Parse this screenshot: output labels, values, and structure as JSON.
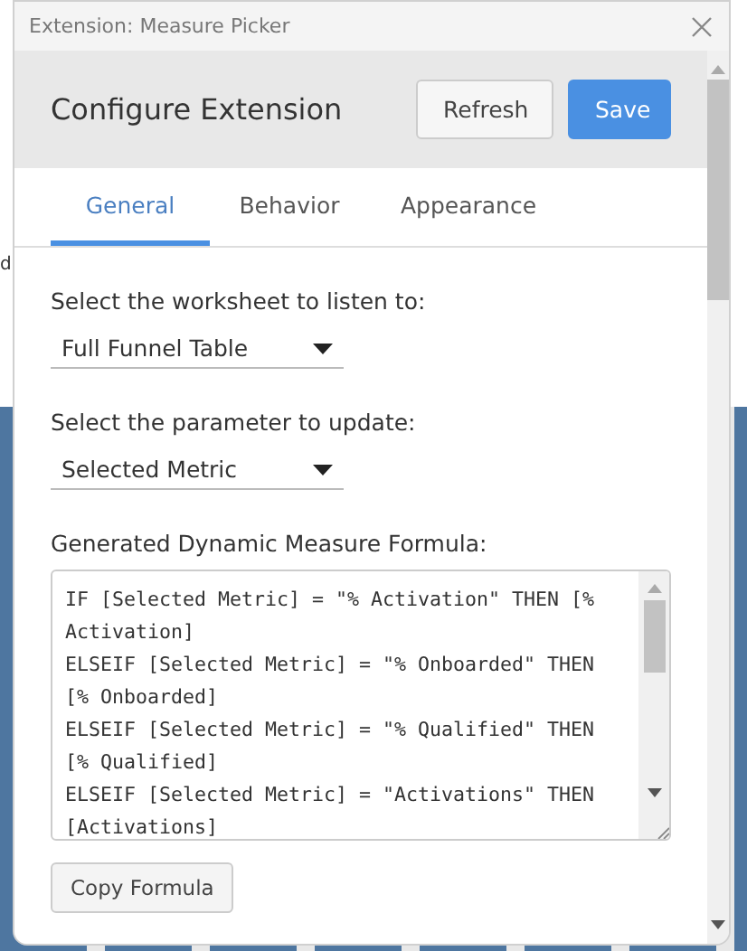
{
  "background_text": "d",
  "window": {
    "title": "Extension: Measure Picker"
  },
  "header": {
    "title": "Configure Extension",
    "buttons": [
      {
        "label": "Refresh",
        "kind": "secondary"
      },
      {
        "label": "Save",
        "kind": "primary"
      }
    ]
  },
  "tabs": [
    {
      "label": "General",
      "selected": true
    },
    {
      "label": "Behavior",
      "selected": false
    },
    {
      "label": "Appearance",
      "selected": false
    }
  ],
  "worksheet": {
    "label": "Select the worksheet to listen to:",
    "value": "Full Funnel Table"
  },
  "parameter": {
    "label": "Select the parameter to update:",
    "value": "Selected Metric"
  },
  "formula": {
    "label": "Generated Dynamic Measure Formula:",
    "lines": [
      "IF [Selected Metric] = \"% Activation\" THEN [% Activation]",
      "ELSEIF [Selected Metric] = \"% Onboarded\" THEN [% Onboarded]",
      "ELSEIF [Selected Metric] = \"% Qualified\" THEN [% Qualified]",
      "ELSEIF [Selected Metric] = \"Activations\" THEN [Activations]"
    ]
  },
  "copy_button": "Copy Formula"
}
